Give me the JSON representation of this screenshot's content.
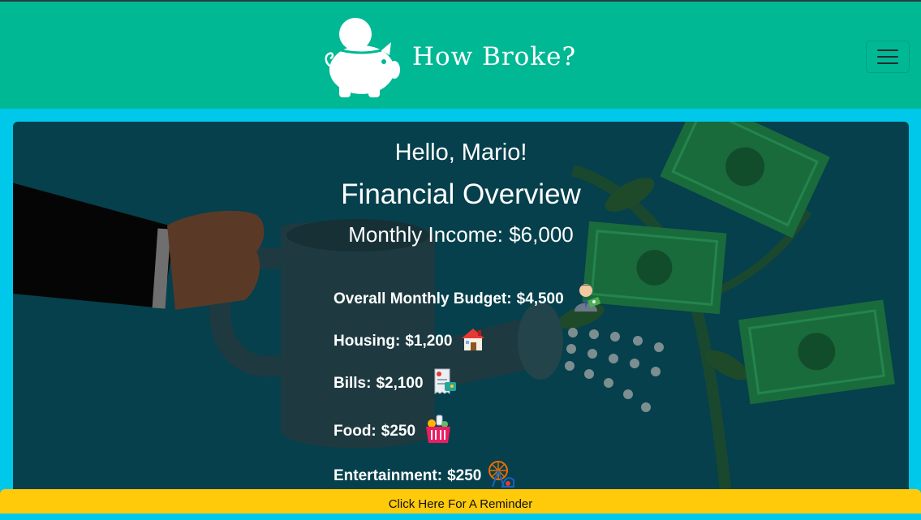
{
  "brand": {
    "name": "How Broke?"
  },
  "hero": {
    "greeting": "Hello, Mario!",
    "heading": "Financial Overview",
    "income_label": "Monthly Income: $6,000"
  },
  "budget_items": [
    {
      "label": "Overall Monthly Budget:",
      "value": "$4,500",
      "icon": "businessman-money-icon"
    },
    {
      "label": "Housing:",
      "value": "$1,200",
      "icon": "house-icon"
    },
    {
      "label": "Bills:",
      "value": "$2,100",
      "icon": "receipt-icon"
    },
    {
      "label": "Food:",
      "value": "$250",
      "icon": "grocery-basket-icon"
    },
    {
      "label": "Entertainment:",
      "value": "$250",
      "icon": "ferris-wheel-icon"
    }
  ],
  "footer": {
    "reminder_label": "Click Here For A Reminder"
  },
  "colors": {
    "navbar": "#00b894",
    "page": "#00c8eb",
    "card": "#05404c",
    "reminder": "#ffca0a"
  }
}
